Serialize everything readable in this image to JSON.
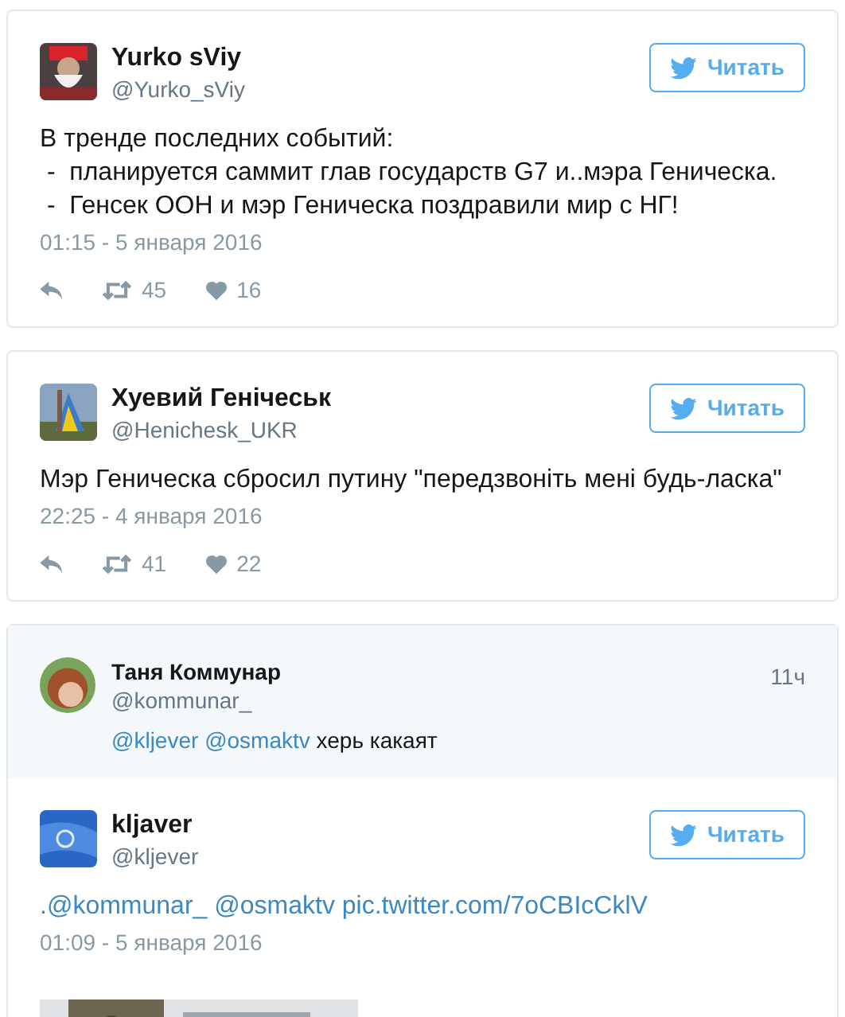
{
  "cards": [
    {
      "tweets": [
        {
          "kind": "tweet",
          "name": "Yurko sViy",
          "handle": "@Yurko_sViy",
          "follow_label": "Читать",
          "lines": [
            [
              {
                "text": "В тренде последних событий:",
                "link": false
              }
            ],
            [
              {
                "text": " -  планируется саммит глав государств G7 и..мэра Геническа.",
                "link": false
              }
            ],
            [
              {
                "text": " -  Генсек ООН и мэр Геническа поздравили мир с НГ!",
                "link": false
              }
            ]
          ],
          "time": "01:15 - 5 января 2016",
          "retweets": "45",
          "likes": "16"
        }
      ]
    },
    {
      "tweets": [
        {
          "kind": "tweet",
          "name": "Хуевий Генічеськ",
          "handle": "@Henichesk_UKR",
          "follow_label": "Читать",
          "lines": [
            [
              {
                "text": "Мэр Геническа сбросил путину \"передзвоніть мені будь-ласка\"",
                "link": false
              }
            ]
          ],
          "time": "22:25 - 4 января 2016",
          "retweets": "41",
          "likes": "22"
        }
      ]
    },
    {
      "tweets": [
        {
          "kind": "reply",
          "name": "Таня Коммунар",
          "handle": "@kommunar_",
          "age": "11ч",
          "lines": [
            [
              {
                "text": "@kljever",
                "link": true
              },
              {
                "text": "@osmaktv",
                "link": true
              },
              {
                "text": "херь какаят",
                "link": false
              }
            ]
          ]
        },
        {
          "kind": "tweet",
          "name": "kljaver",
          "handle": "@kljever",
          "follow_label": "Читать",
          "lines": [
            [
              {
                "text": ".@kommunar_",
                "link": true
              },
              {
                "text": "@osmaktv",
                "link": true
              },
              {
                "text": "pic.twitter.com/7oCBIcCklV",
                "link": true
              }
            ]
          ],
          "time": "01:09 - 5 января 2016",
          "has_picture": true
        }
      ]
    }
  ]
}
